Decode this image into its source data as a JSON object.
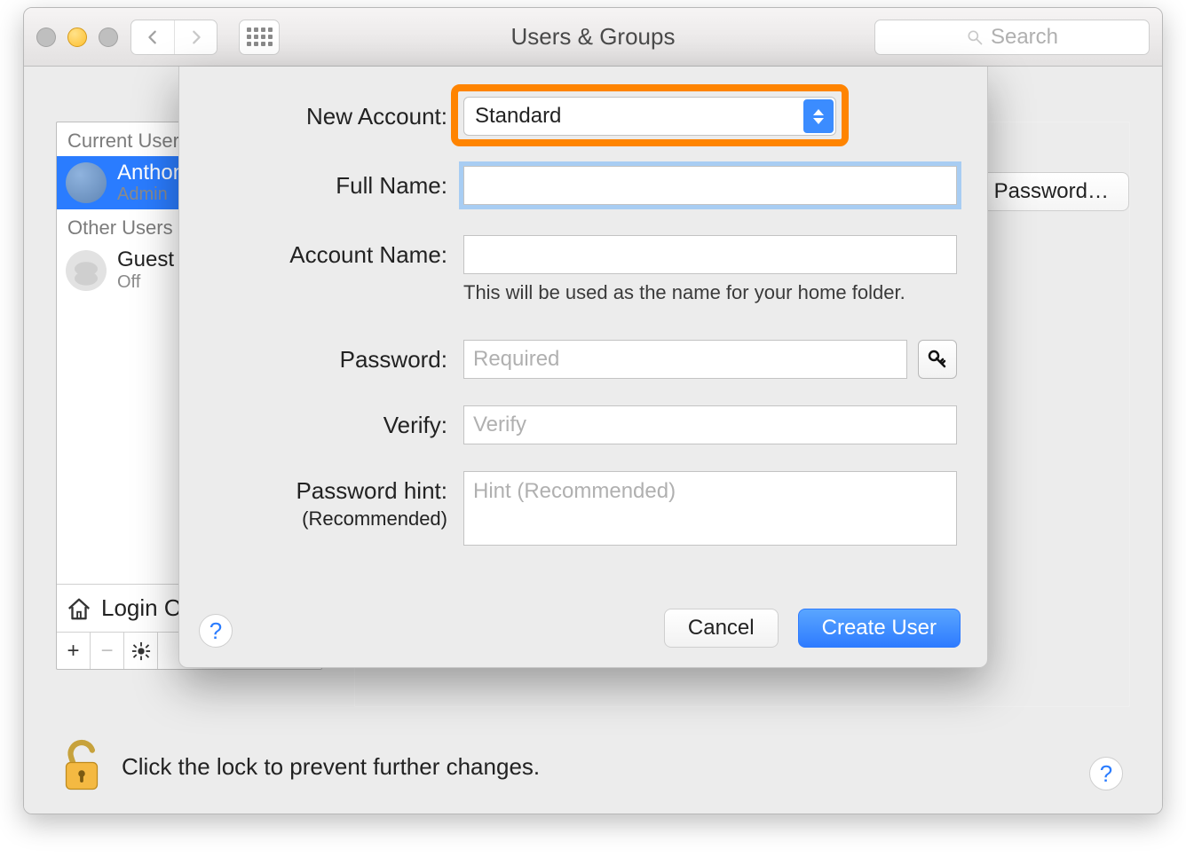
{
  "window": {
    "title": "Users & Groups",
    "search_placeholder": "Search"
  },
  "sidebar": {
    "section_current": "Current User",
    "section_other": "Other Users",
    "current_user": {
      "name": "Anthony",
      "role": "Admin"
    },
    "other_users": [
      {
        "name": "Guest User",
        "status": "Off"
      }
    ],
    "login_options_label": "Login Options"
  },
  "details": {
    "change_password_label": "Change Password…"
  },
  "sheet": {
    "labels": {
      "new_account": "New Account:",
      "full_name": "Full Name:",
      "account_name": "Account Name:",
      "account_name_hint": "This will be used as the name for your home folder.",
      "password": "Password:",
      "verify": "Verify:",
      "password_hint": "Password hint:",
      "password_hint_sub": "(Recommended)"
    },
    "values": {
      "new_account": "Standard",
      "full_name": "",
      "account_name": "",
      "password": "",
      "verify": "",
      "password_hint": ""
    },
    "placeholders": {
      "password": "Required",
      "verify": "Verify",
      "password_hint": "Hint (Recommended)"
    },
    "buttons": {
      "cancel": "Cancel",
      "create_user": "Create User"
    }
  },
  "footer": {
    "lock_text": "Click the lock to prevent further changes."
  }
}
